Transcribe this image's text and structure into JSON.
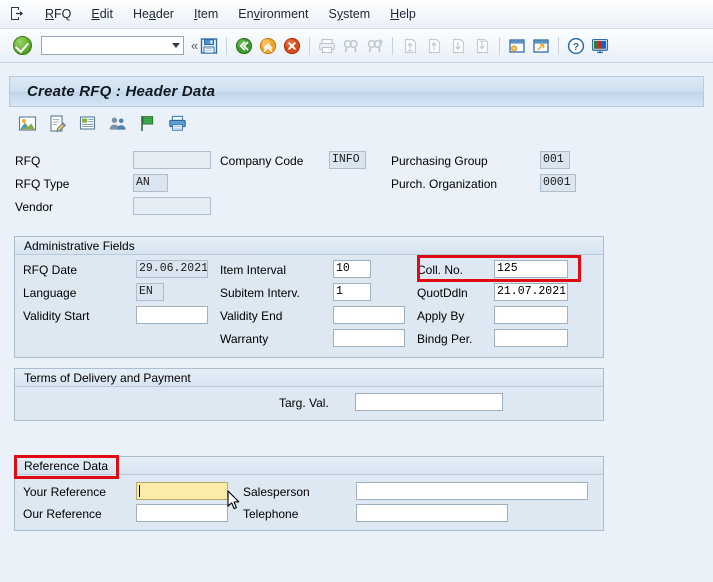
{
  "window": {
    "title": "Create RFQ : Header Data"
  },
  "menubar": {
    "system_icon": "sap-system-menu-icon",
    "items": [
      {
        "label": "RFQ",
        "accel_index": 0
      },
      {
        "label": "Edit",
        "accel_index": 0
      },
      {
        "label": "Header",
        "accel_index": 2
      },
      {
        "label": "Item",
        "accel_index": 0
      },
      {
        "label": "Environment",
        "accel_index": 3
      },
      {
        "label": "System",
        "accel_index": 1
      },
      {
        "label": "Help",
        "accel_index": 0
      }
    ]
  },
  "toolbar": {
    "enter_tooltip": "Enter",
    "command_field": {
      "value": "",
      "placeholder": ""
    },
    "collapse_label": "«",
    "icons": [
      {
        "name": "save-icon",
        "enabled": true
      },
      {
        "name": "back-icon",
        "enabled": true
      },
      {
        "name": "exit-icon",
        "enabled": true
      },
      {
        "name": "cancel-icon",
        "enabled": true
      },
      {
        "name": "print-icon",
        "enabled": false
      },
      {
        "name": "find-icon",
        "enabled": false
      },
      {
        "name": "find-next-icon",
        "enabled": false
      },
      {
        "name": "first-page-icon",
        "enabled": false
      },
      {
        "name": "previous-page-icon",
        "enabled": false
      },
      {
        "name": "next-page-icon",
        "enabled": false
      },
      {
        "name": "last-page-icon",
        "enabled": false
      },
      {
        "name": "create-session-icon",
        "enabled": true
      },
      {
        "name": "create-shortcut-icon",
        "enabled": true
      },
      {
        "name": "help-icon",
        "enabled": true
      },
      {
        "name": "customize-local-layout-icon",
        "enabled": true
      }
    ]
  },
  "app_toolbar": {
    "icons": [
      {
        "name": "overview-icon"
      },
      {
        "name": "header-details-icon"
      },
      {
        "name": "header-texts-icon"
      },
      {
        "name": "partners-icon"
      },
      {
        "name": "flag-icon"
      },
      {
        "name": "print-preview-icon"
      }
    ]
  },
  "header_fields": {
    "rfq": {
      "label": "RFQ",
      "value": ""
    },
    "rfq_type": {
      "label": "RFQ Type",
      "value": "AN"
    },
    "vendor": {
      "label": "Vendor",
      "value": ""
    },
    "company_code": {
      "label": "Company Code",
      "value": "INFO"
    },
    "purchasing_group": {
      "label": "Purchasing Group",
      "value": "001"
    },
    "purch_organization": {
      "label": "Purch. Organization",
      "value": "0001"
    }
  },
  "administrative_fields": {
    "title": "Administrative Fields",
    "rfq_date": {
      "label": "RFQ Date",
      "value": "29.06.2021"
    },
    "language": {
      "label": "Language",
      "value": "EN"
    },
    "validity_start": {
      "label": "Validity Start",
      "value": ""
    },
    "item_interval": {
      "label": "Item Interval",
      "value": "10"
    },
    "subitem_interv": {
      "label": "Subitem Interv.",
      "value": "1"
    },
    "validity_end": {
      "label": "Validity End",
      "value": ""
    },
    "warranty": {
      "label": "Warranty",
      "value": ""
    },
    "coll_no": {
      "label": "Coll. No.",
      "value": "125",
      "highlighted": true
    },
    "quot_ddln": {
      "label": "QuotDdln",
      "value": "21.07.2021"
    },
    "apply_by": {
      "label": "Apply By",
      "value": ""
    },
    "bindg_per": {
      "label": "Bindg Per.",
      "value": ""
    }
  },
  "terms_section": {
    "title": "Terms of Delivery and Payment",
    "targ_val": {
      "label": "Targ. Val.",
      "value": ""
    }
  },
  "reference_section": {
    "title": "Reference Data",
    "title_highlighted": true,
    "your_reference": {
      "label": "Your Reference",
      "value": "",
      "focused": true
    },
    "our_reference": {
      "label": "Our Reference",
      "value": ""
    },
    "salesperson": {
      "label": "Salesperson",
      "value": ""
    },
    "telephone": {
      "label": "Telephone",
      "value": ""
    }
  },
  "annotations": {
    "highlight_color": "#e00b12",
    "focus_field_color": "#fbeca8"
  }
}
